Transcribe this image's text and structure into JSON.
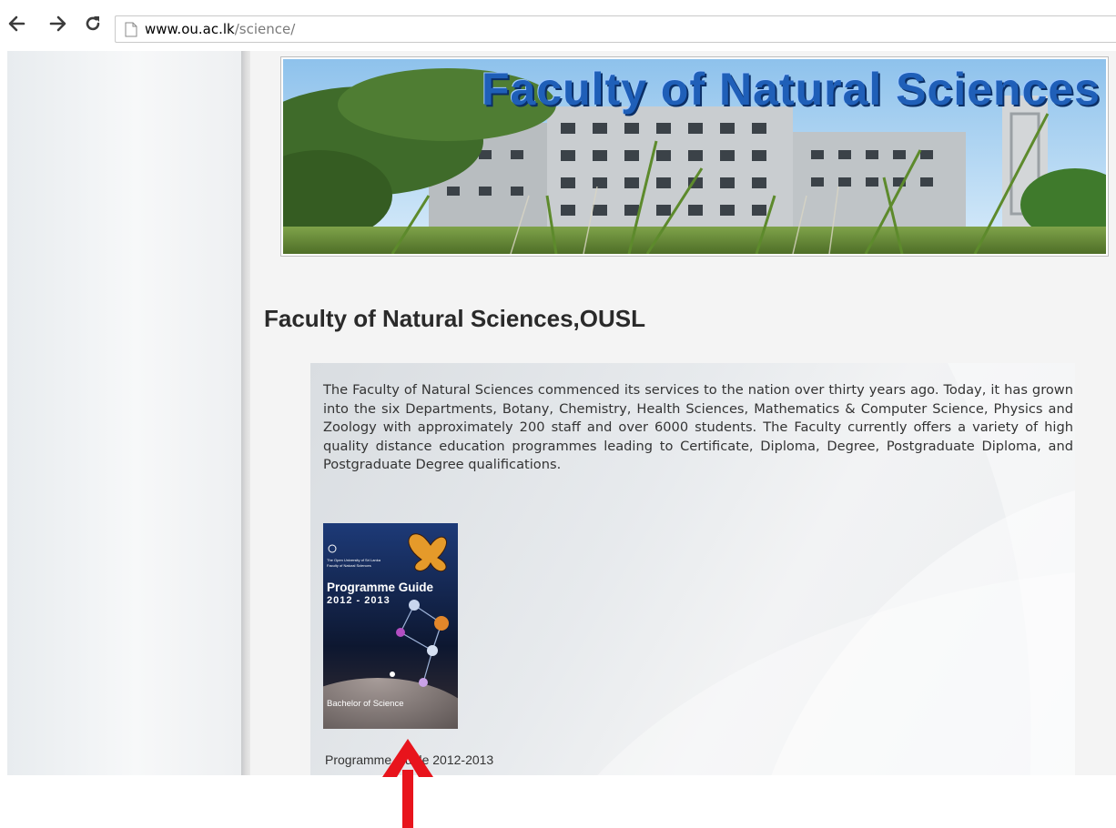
{
  "browser": {
    "back_icon": "arrow-left-icon",
    "forward_icon": "arrow-right-icon",
    "reload_icon": "reload-icon",
    "url_domain": "www.ou.ac.lk",
    "url_path": "/science/"
  },
  "banner": {
    "title": "Faculty of Natural Sciences"
  },
  "page": {
    "title": "Faculty of Natural Sciences,OUSL",
    "intro": "The Faculty of Natural Sciences commenced its services to the nation over thirty years ago. Today, it has grown into the six Departments, Botany, Chemistry, Health Sciences, Mathematics & Computer Science, Physics and Zoology with approximately 200 staff and over 6000 students. The Faculty currently offers a variety of high quality distance education programmes leading to Certificate, Diploma, Degree, Postgraduate Diploma, and Postgraduate Degree qualifications."
  },
  "guide": {
    "publisher_line1": "The Open University of Sri Lanka",
    "publisher_line2": "Faculty of Natural Sciences",
    "cover_title": "Programme Guide",
    "cover_years": "2012 - 2013",
    "cover_footer": "Bachelor of Science",
    "caption": "Programme Guide 2012-2013"
  },
  "colors": {
    "banner_title": "#1f5fb8",
    "annotation_arrow": "#e8141c",
    "guide_cover": "#1d3a78"
  }
}
